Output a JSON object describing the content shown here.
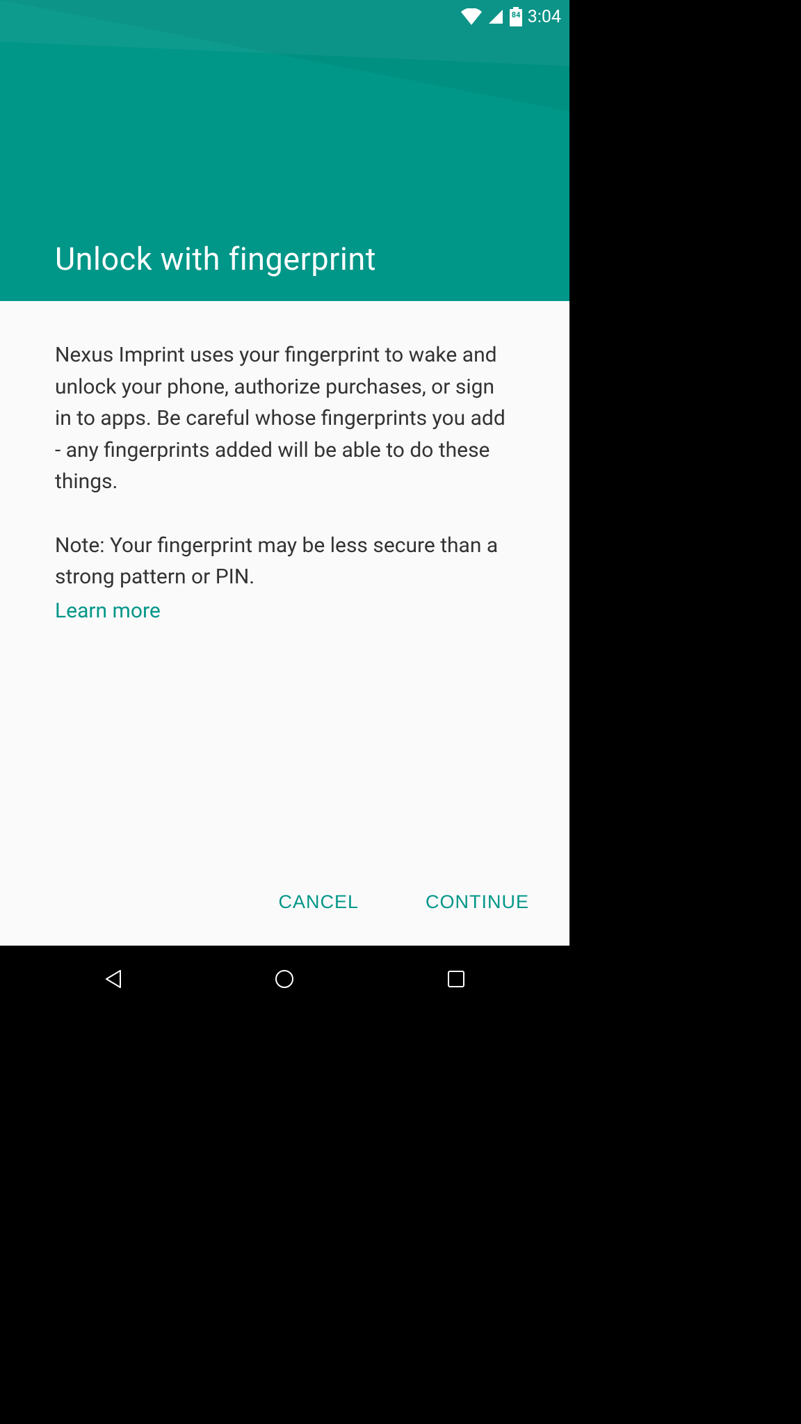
{
  "status_bar": {
    "battery_level": "84",
    "time": "3:04"
  },
  "header": {
    "title": "Unlock with fingerprint"
  },
  "content": {
    "paragraph1": "Nexus Imprint uses your fingerprint to wake and unlock your phone, authorize purchases, or sign in to apps. Be careful whose fingerprints you add - any fingerprints added will be able to do these things.",
    "paragraph2": "Note: Your fingerprint may be less secure than a strong pattern or PIN.",
    "learn_more_label": "Learn more"
  },
  "buttons": {
    "cancel_label": "CANCEL",
    "continue_label": "CONTINUE"
  },
  "colors": {
    "accent": "#009688"
  }
}
